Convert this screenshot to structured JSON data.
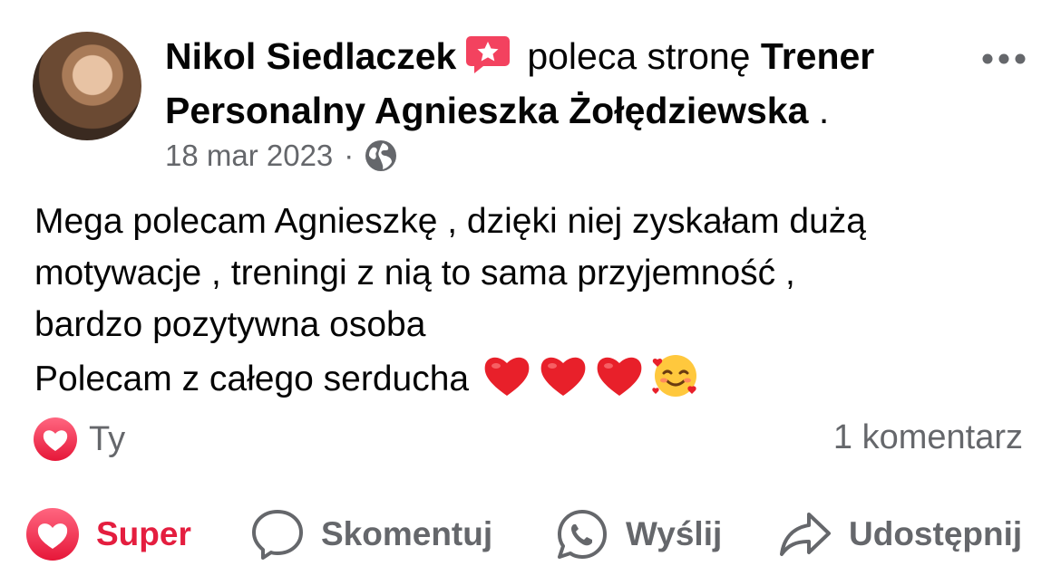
{
  "post": {
    "author": "Nikol Siedlaczek",
    "action_text": "poleca stronę",
    "page_name": "Trener Personalny Agnieszka Żołędziewska",
    "trailing": ".",
    "date": "18 mar 2023",
    "separator": "·",
    "audience_icon": "globe-icon",
    "recommend_icon": "recommendation-star-icon",
    "body_lines": [
      "Mega polecam Agnieszkę , dzięki niej zyskałam dużą",
      "motywacje , treningi z nią to sama przyjemność ,",
      "bardzo pozytywna osoba",
      "Polecam z całego serducha"
    ],
    "emojis": [
      "red-heart-emoji",
      "red-heart-emoji",
      "red-heart-emoji",
      "smiling-face-with-hearts-emoji"
    ]
  },
  "stats": {
    "reaction_icon": "love-reaction-icon",
    "reactors": "Ty",
    "comments": "1 komentarz"
  },
  "actions": {
    "super": "Super",
    "comment": "Skomentuj",
    "send": "Wyślij",
    "share": "Udostępnij"
  },
  "colors": {
    "love": "#f33e58",
    "active_reaction": "#e41e3f",
    "secondary_text": "#65676b",
    "recommend_badge": "#f3425f"
  }
}
